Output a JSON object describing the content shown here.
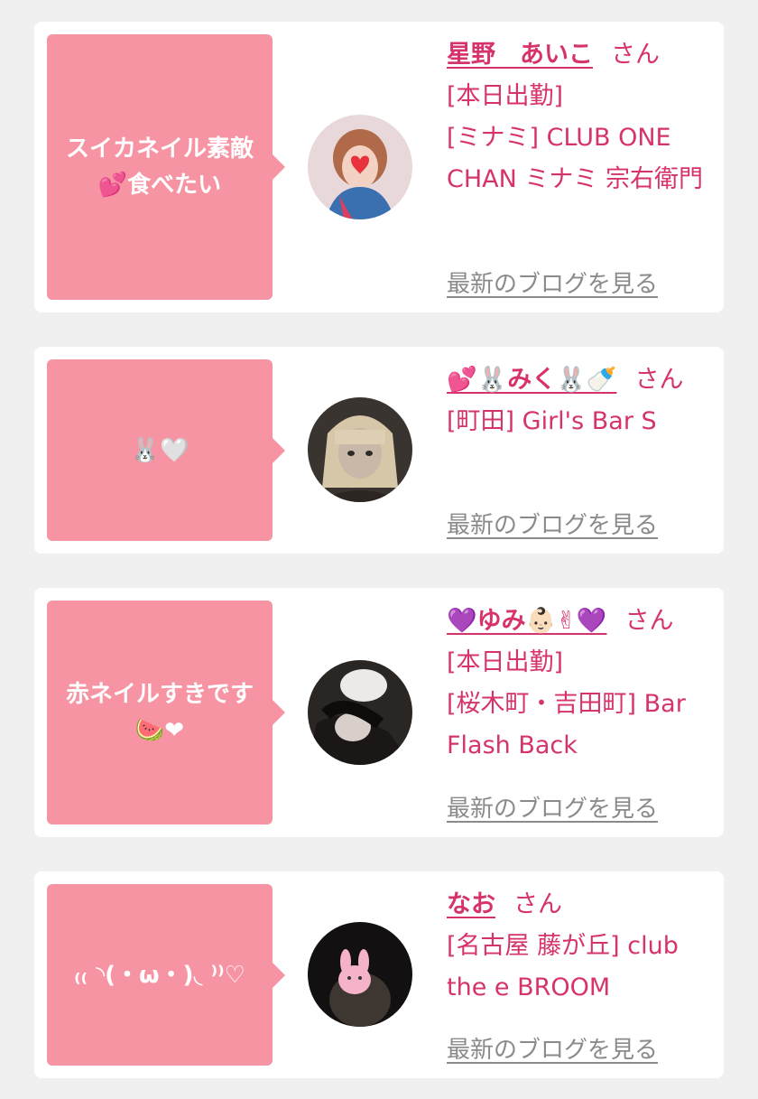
{
  "cards": [
    {
      "bubble": "スイカネイル素敵\n💕食べたい",
      "name": "星野　あいこ",
      "san": "さん",
      "line1": "[本日出勤]",
      "shop": "[ミナミ] CLUB ONE CHAN ミナミ 宗右衛門",
      "blog": "最新のブログを見る"
    },
    {
      "bubble": "🐰🤍",
      "name": "💕🐰みく🐰🍼",
      "san": "さん",
      "line1": "",
      "shop": "[町田] Girl's Bar S",
      "blog": "最新のブログを見る"
    },
    {
      "bubble": "赤ネイルすきです\n🍉❤",
      "name": "💜ゆみ👶🏻✌💜",
      "san": "さん",
      "line1": "[本日出勤]",
      "shop": "[桜木町・吉田町] Bar Flash Back",
      "blog": "最新のブログを見る"
    },
    {
      "bubble": "₍₍ ◝(・ω・)◟ ⁾⁾♡",
      "name": "なお",
      "san": "さん",
      "line1": "",
      "shop": "[名古屋 藤が丘] club the e BROOM",
      "blog": "最新のブログを見る"
    }
  ],
  "colors": {
    "accent": "#d6336c",
    "bubble": "#f794a4",
    "link_gray": "#8a8a8a",
    "background": "#f0f0f0"
  }
}
